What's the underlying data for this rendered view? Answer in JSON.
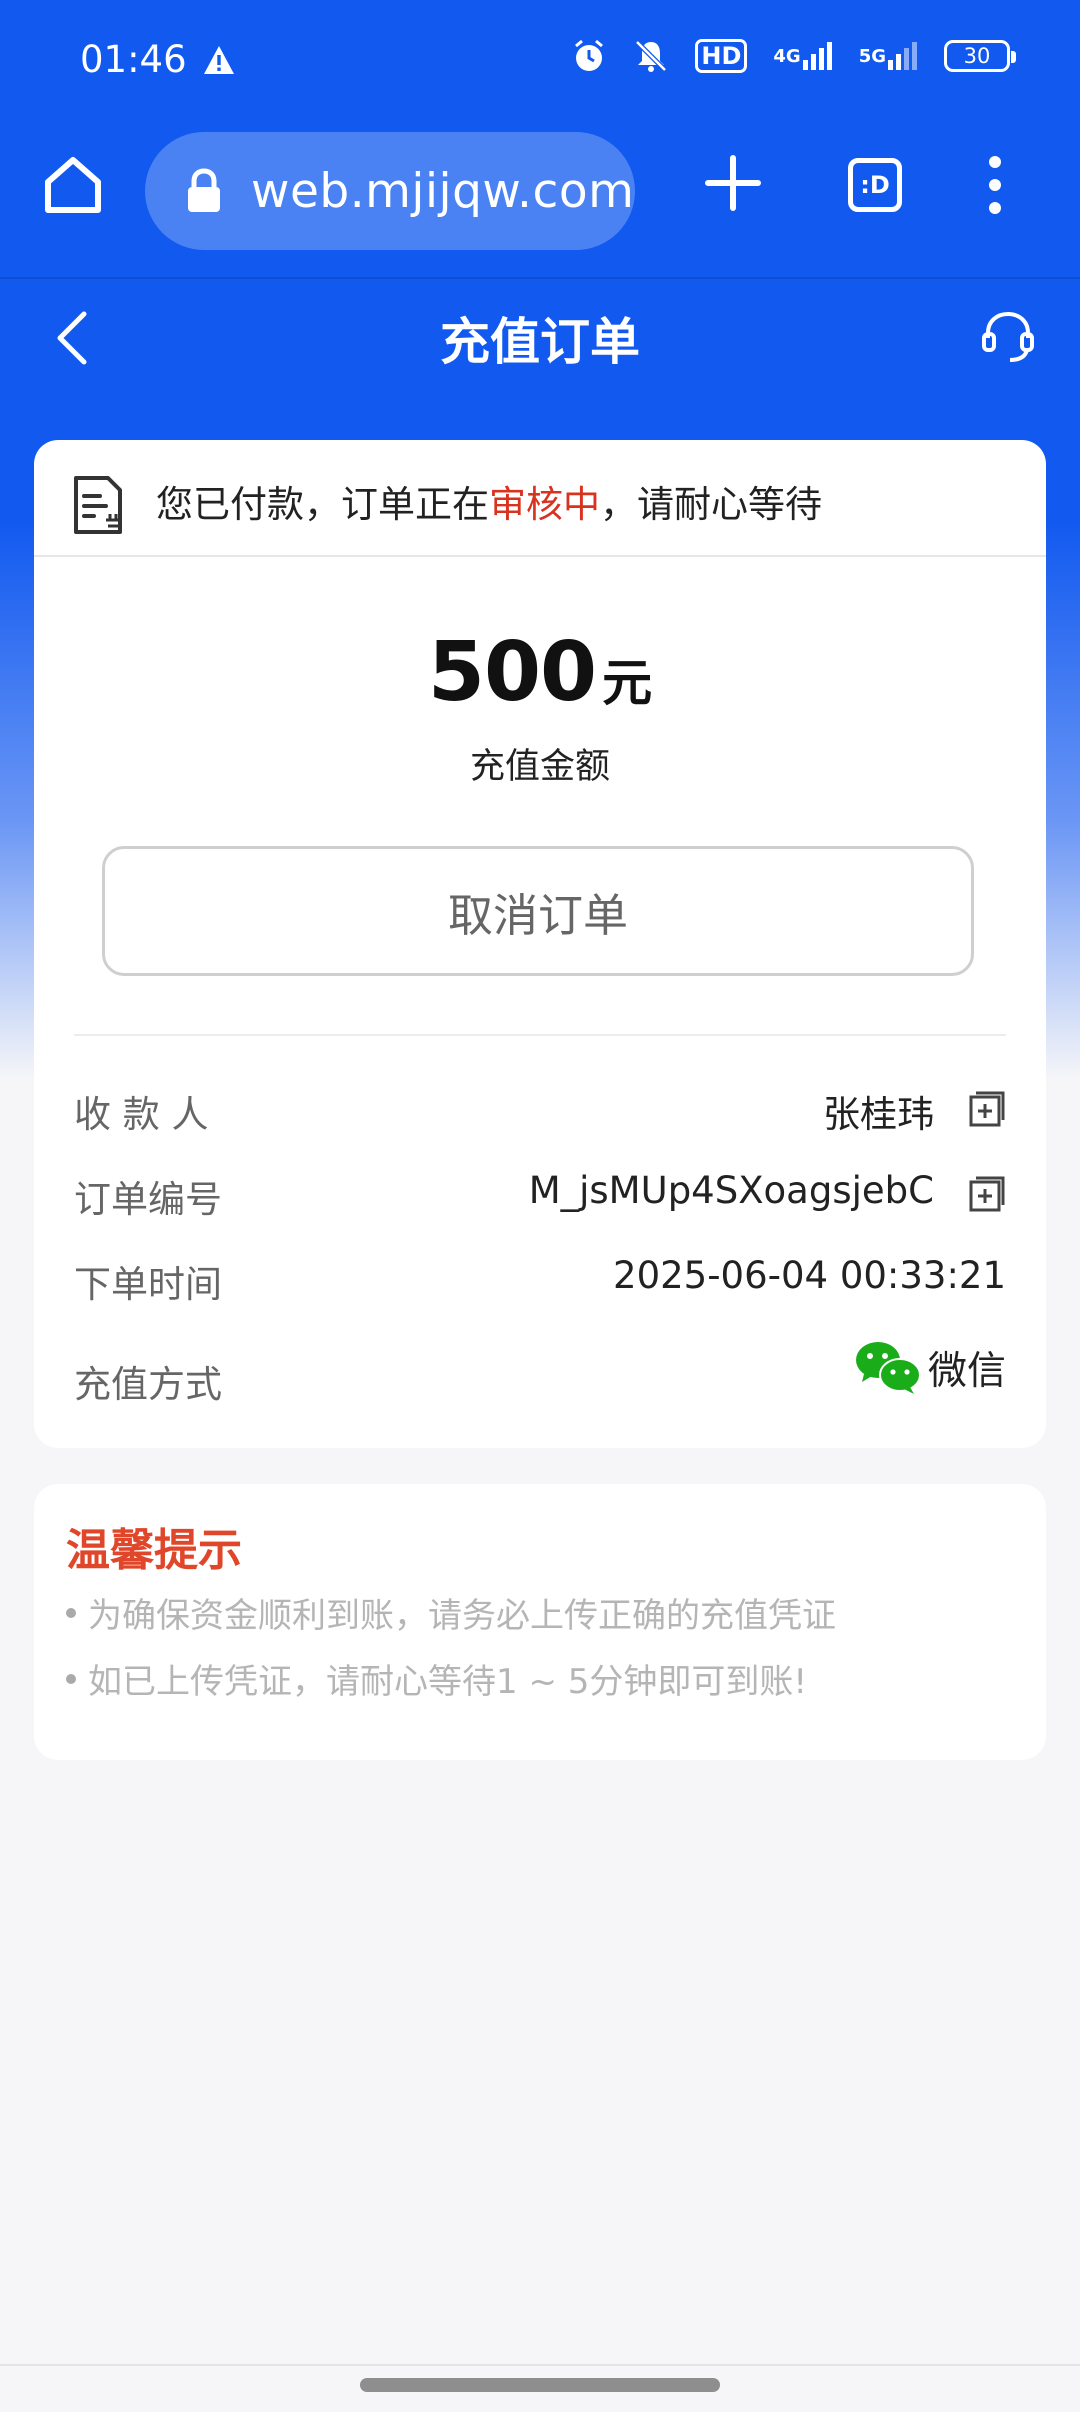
{
  "status_bar": {
    "time": "01:46",
    "hd_badge": "HD",
    "net_1": "4G",
    "net_2": "5G",
    "battery": "30"
  },
  "browser": {
    "url": "web.mjijqw.com/",
    "tabs_label": ":D"
  },
  "header": {
    "title": "充值订单"
  },
  "order": {
    "notice_prefix": "您已付款，订单正在",
    "notice_highlight": "审核中",
    "notice_suffix": "，请耐心等待",
    "amount": "500",
    "amount_unit": "元",
    "amount_label": "充值金额",
    "cancel_label": "取消订单",
    "rows": [
      {
        "label": "收 款 人",
        "value": "张桂玮"
      },
      {
        "label": "订单编号",
        "value": "M_jsMUp4SXoagsjebC"
      },
      {
        "label": "下单时间",
        "value": "2025-06-04 00:33:21"
      },
      {
        "label": "充值方式",
        "value": "微信"
      }
    ]
  },
  "tips": {
    "title": "温馨提示",
    "items": [
      "为确保资金顺利到账，请务必上传正确的充值凭证",
      "如已上传凭证，请耐心等待1 ~ 5分钟即可到账!"
    ]
  },
  "colors": {
    "primary": "#1159ef",
    "highlight": "#d8331f",
    "tips_title": "#e0462a",
    "wechat": "#1aad19"
  }
}
